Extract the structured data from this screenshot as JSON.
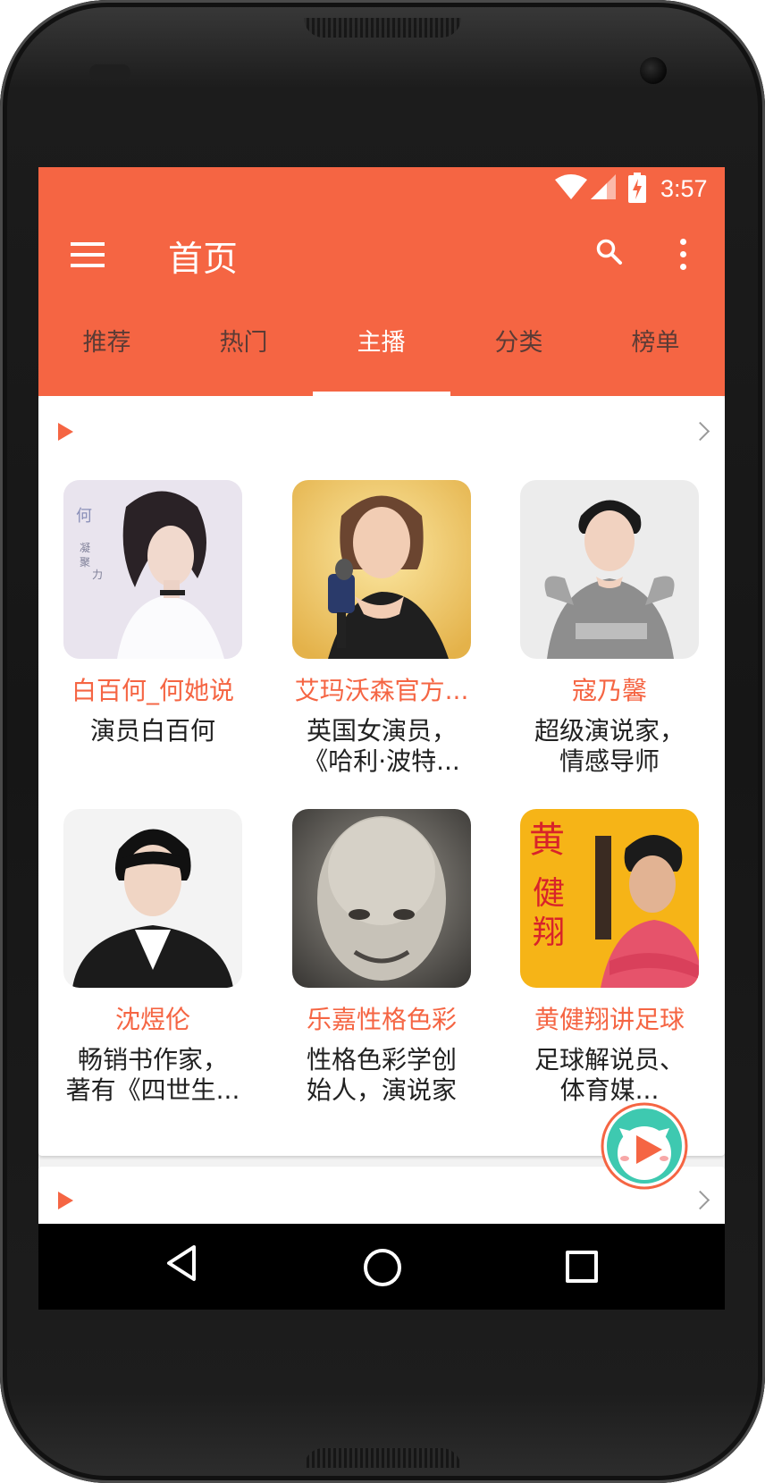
{
  "status_bar": {
    "time": "3:57"
  },
  "toolbar": {
    "title": "首页"
  },
  "tabs": [
    {
      "label": "推荐",
      "active": false
    },
    {
      "label": "热门",
      "active": false
    },
    {
      "label": "主播",
      "active": true
    },
    {
      "label": "分类",
      "active": false
    },
    {
      "label": "榜单",
      "active": false
    }
  ],
  "anchors": [
    {
      "name": "白百何_何她说",
      "desc_line1": "演员白百何",
      "desc_line2": "",
      "avatar": "photo-woman-white-top"
    },
    {
      "name": "艾玛沃森官方...",
      "desc_line1": "英国女演员，",
      "desc_line2": "《哈利·波特...",
      "avatar": "photo-woman-microphone"
    },
    {
      "name": "寇乃馨",
      "desc_line1": "超级演说家，",
      "desc_line2": "情感导师",
      "avatar": "photo-woman-silver-dress"
    },
    {
      "name": "沈煜伦",
      "desc_line1": "畅销书作家，",
      "desc_line2": "著有《四世生...",
      "avatar": "photo-man-suit"
    },
    {
      "name": "乐嘉性格色彩",
      "desc_line1": "性格色彩学创",
      "desc_line2": "始人，演说家",
      "avatar": "photo-bald-man"
    },
    {
      "name": "黄健翔讲足球",
      "desc_line1": "足球解说员、",
      "desc_line2": "体育媒...",
      "avatar": "poster-man-pink-shirt"
    }
  ],
  "colors": {
    "accent": "#f56543",
    "tab_inactive": "#5c3b35",
    "fab_ring": "#3ec9b0"
  }
}
